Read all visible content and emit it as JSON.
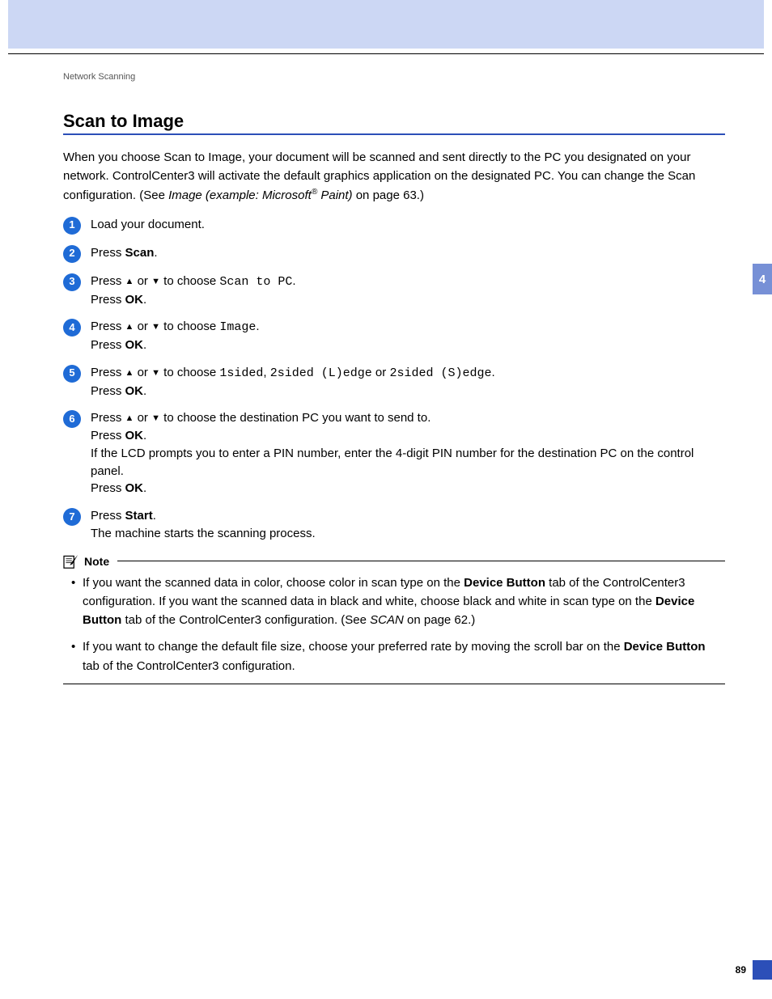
{
  "breadcrumb": "Network Scanning",
  "title": "Scan to Image",
  "intro": {
    "text_a": "When you choose Scan to Image, your document will be scanned and sent directly to the PC you designated on your network. ControlCenter3 will activate the default graphics application on the designated PC. You can change the Scan configuration. (See ",
    "xref": "Image (example: Microsoft",
    "sup": "®",
    "xref_tail": " Paint)",
    "text_b": " on page 63.)"
  },
  "steps": [
    {
      "n": "1",
      "lines": [
        "Load your document."
      ]
    },
    {
      "n": "2",
      "lines": [
        "Press <b>Scan</b>."
      ]
    },
    {
      "n": "3",
      "lines": [
        "Press <span class='icon-up'>▲</span> or <span class='icon-down'>▼</span> to choose <span class='mono'>Scan to PC</span>.",
        "Press <b>OK</b>."
      ]
    },
    {
      "n": "4",
      "lines": [
        "Press <span class='icon-up'>▲</span> or <span class='icon-down'>▼</span> to choose <span class='mono'>Image</span>.",
        "Press <b>OK</b>."
      ]
    },
    {
      "n": "5",
      "lines": [
        "Press <span class='icon-up'>▲</span> or <span class='icon-down'>▼</span> to choose <span class='mono'>1sided</span>, <span class='mono'>2sided (L)edge</span> or <span class='mono'>2sided (S)edge</span>.",
        "Press <b>OK</b>."
      ]
    },
    {
      "n": "6",
      "lines": [
        "Press <span class='icon-up'>▲</span> or <span class='icon-down'>▼</span> to choose the destination PC you want to send to.",
        "Press <b>OK</b>.",
        "If the LCD prompts you to enter a PIN number, enter the 4-digit PIN number for the destination PC on the control panel.",
        "Press <b>OK</b>."
      ]
    },
    {
      "n": "7",
      "lines": [
        "Press <b>Start</b>.",
        "The machine starts the scanning process."
      ]
    }
  ],
  "note_label": "Note",
  "notes": [
    "If you want the scanned data in color, choose color in scan type on the <b>Device Button</b> tab of the ControlCenter3 configuration. If you want the scanned data in black and white, choose black and white in scan type on the <b>Device Button</b> tab of the ControlCenter3 configuration. (See <i>SCAN</i> on page 62.)",
    "If you want to change the default file size, choose your preferred rate by moving the scroll bar on the <b>Device Button</b> tab of the ControlCenter3 configuration."
  ],
  "chapter_tab": "4",
  "page_number": "89"
}
